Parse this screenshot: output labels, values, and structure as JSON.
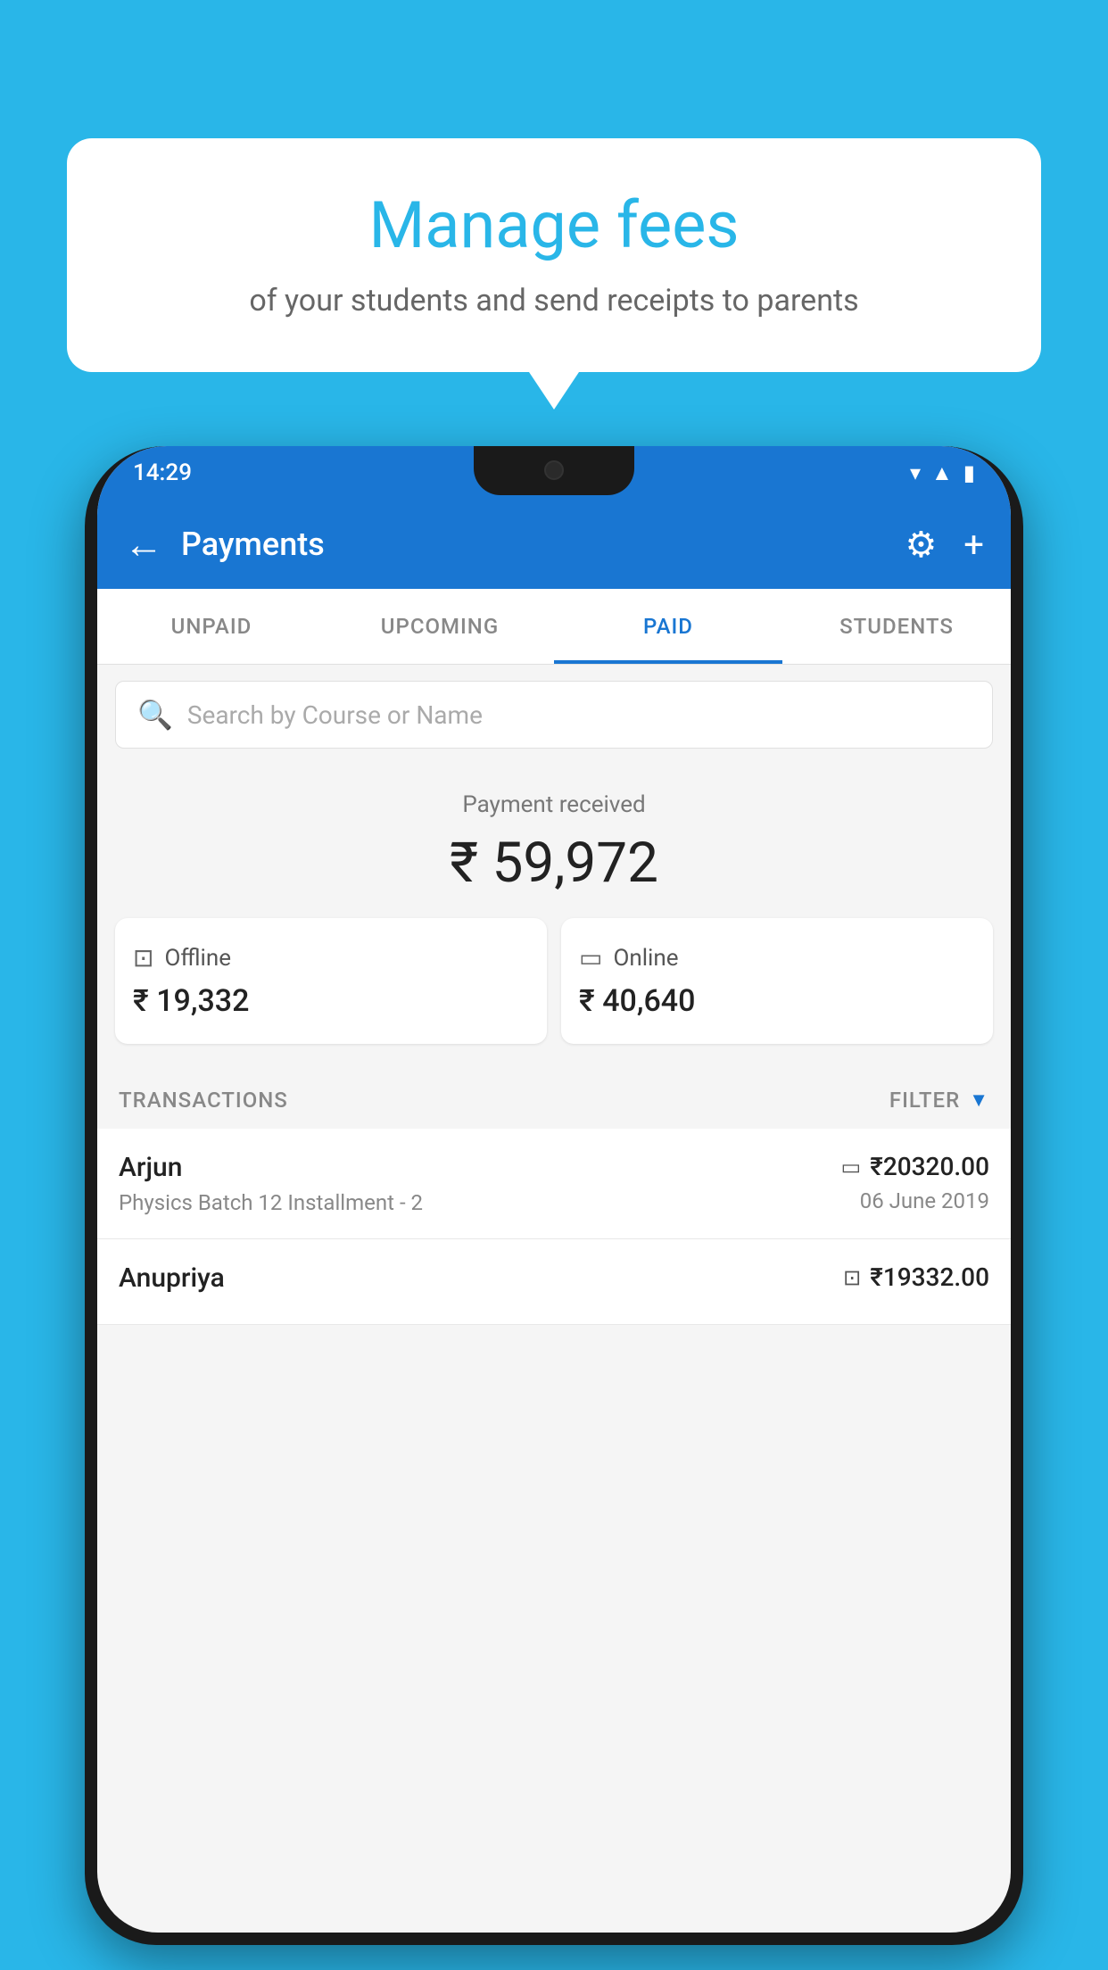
{
  "background_color": "#29B6E8",
  "bubble": {
    "title": "Manage fees",
    "subtitle": "of your students and send receipts to parents"
  },
  "status_bar": {
    "time": "14:29",
    "color": "#1976D2"
  },
  "app_bar": {
    "title": "Payments",
    "back_label": "←",
    "color": "#1976D2"
  },
  "tabs": [
    {
      "label": "UNPAID",
      "active": false
    },
    {
      "label": "UPCOMING",
      "active": false
    },
    {
      "label": "PAID",
      "active": true
    },
    {
      "label": "STUDENTS",
      "active": false
    }
  ],
  "search": {
    "placeholder": "Search by Course or Name"
  },
  "payment_summary": {
    "received_label": "Payment received",
    "amount": "₹ 59,972",
    "offline": {
      "label": "Offline",
      "amount": "₹ 19,332"
    },
    "online": {
      "label": "Online",
      "amount": "₹ 40,640"
    }
  },
  "transactions": {
    "section_label": "TRANSACTIONS",
    "filter_label": "FILTER",
    "rows": [
      {
        "name": "Arjun",
        "description": "Physics Batch 12 Installment - 2",
        "amount": "₹20320.00",
        "date": "06 June 2019",
        "mode": "online"
      },
      {
        "name": "Anupriya",
        "description": "",
        "amount": "₹19332.00",
        "date": "",
        "mode": "offline"
      }
    ]
  }
}
